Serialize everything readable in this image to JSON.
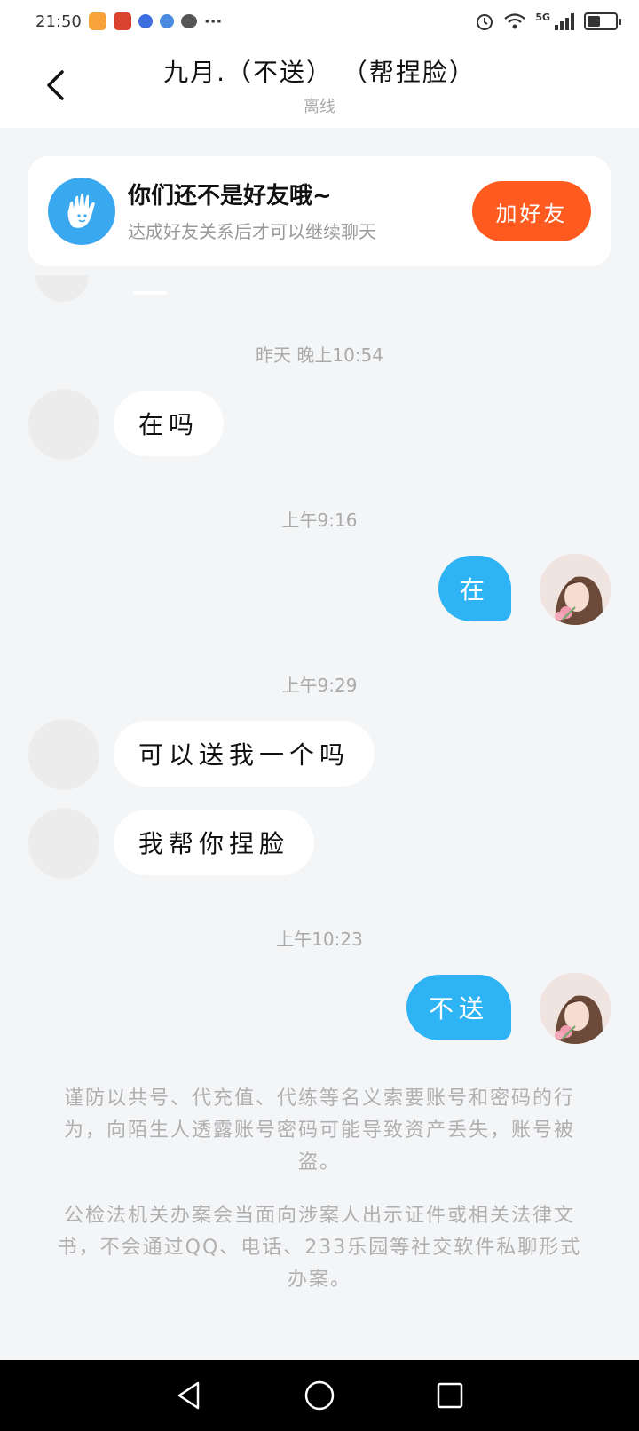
{
  "status_bar": {
    "time": "21:50",
    "more": "···",
    "network": "5G",
    "battery_level": 0.45
  },
  "header": {
    "title": "九月.（不送）  （帮捏脸）",
    "subtitle": "离线"
  },
  "friend_card": {
    "title": "你们还不是好友哦~",
    "desc": "达成好友关系后才可以继续聊天",
    "add_button": "加好友"
  },
  "messages": [
    {
      "time": "昨天 晚上10:54"
    },
    {
      "side": "in",
      "text": "在吗"
    },
    {
      "time": "上午9:16"
    },
    {
      "side": "out",
      "text": "在"
    },
    {
      "time": "上午9:29"
    },
    {
      "side": "in",
      "text": "可以送我一个吗"
    },
    {
      "side": "in",
      "text": "我帮你捏脸"
    },
    {
      "time": "上午10:23"
    },
    {
      "side": "out",
      "text": "不送"
    }
  ],
  "notices": [
    "谨防以共号、代充值、代练等名义索要账号和密码的行为，向陌生人透露账号密码可能导致资产丢失，账号被盗。",
    "公检法机关办案会当面向涉案人出示证件或相关法律文书，不会通过QQ、电话、233乐园等社交软件私聊形式办案。"
  ],
  "colors": {
    "accent_blue": "#2eb3f5",
    "add_button_orange": "#ff5a1f",
    "background": "#f4f5f7"
  },
  "icons": [
    "back-icon",
    "alarm-icon",
    "wifi-icon",
    "signal-icon",
    "battery-icon",
    "hand-wave-icon",
    "nav-back-icon",
    "nav-home-icon",
    "nav-recents-icon"
  ]
}
